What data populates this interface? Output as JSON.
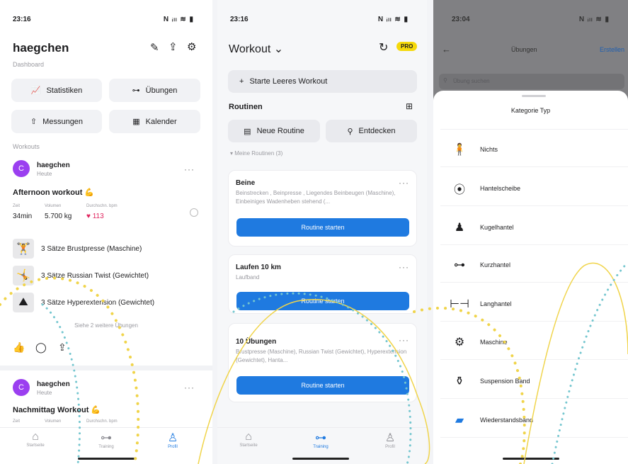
{
  "phone1": {
    "time": "23:16",
    "signal": "N ᵢₗₗ ≋ ▮",
    "user": "haegchen",
    "subtitle": "Dashboard",
    "buttons": {
      "stats": "Statistiken",
      "exercises": "Übungen",
      "measurements": "Messungen",
      "calendar": "Kalender"
    },
    "section": "Workouts",
    "post1": {
      "avatar": "C",
      "name": "haegchen",
      "when": "Heute",
      "title": "Afternoon workout 💪",
      "stat_labels": [
        "Zeit",
        "Volumen",
        "Durchschn. bpm"
      ],
      "stat_values": [
        "34min",
        "5.700 kg",
        "♥ 113"
      ],
      "exercises": [
        "3 Sätze Brustpresse (Maschine)",
        "3 Sätze Russian Twist (Gewichtet)",
        "3 Sätze Hyperextension (Gewichtet)"
      ],
      "more": "Siehe 2 weitere Übungen"
    },
    "post2": {
      "avatar": "C",
      "name": "haegchen",
      "when": "Heute",
      "title": "Nachmittag Workout 💪",
      "stat_labels": [
        "Zeit",
        "Volumen",
        "Durchschn. bpm"
      ]
    },
    "tabs": [
      "Startseite",
      "Training",
      "Profil"
    ]
  },
  "phone2": {
    "time": "23:16",
    "signal": "N ᵢₗₗ ≋ ▮",
    "title": "Workout ⌄",
    "pro": "PRO",
    "start_empty": "Starte Leeres Workout",
    "routines_header": "Routinen",
    "new_routine": "Neue Routine",
    "discover": "Entdecken",
    "my_routines": "Meine Routinen (3)",
    "routines": [
      {
        "title": "Beine",
        "desc": "Beinstrecken , Beinpresse , Liegendes Beinbeugen (Maschine), Einbeiniges Wadenheben stehend (...",
        "btn": "Routine starten"
      },
      {
        "title": "Laufen 10 km",
        "desc": "Laufband",
        "btn": "Routine starten"
      },
      {
        "title": "10 Übungen",
        "desc": "Brustpresse (Maschine), Russian Twist (Gewichtet), Hyperextension (Gewichtet), Hanta...",
        "btn": "Routine starten"
      }
    ],
    "tabs": [
      "Startseite",
      "Training",
      "Profil"
    ]
  },
  "phone3": {
    "time": "23:04",
    "signal": "N ᵢₗₗ ≋ ▮",
    "title": "Übungen",
    "create": "Erstellen",
    "search_placeholder": "Übung suchen",
    "sheet_title": "Kategorie Typ",
    "categories": [
      "Nichts",
      "Hantelscheibe",
      "Kugelhantel",
      "Kurzhantel",
      "Langhantel",
      "Maschine",
      "Suspension Band",
      "Wiederstandsband"
    ]
  },
  "colors": {
    "accent": "#1f7ae0",
    "pro": "#f5d90a",
    "heart": "#e0245e",
    "overlay_yellow": "#f0d44a",
    "overlay_teal": "#74c6cf"
  }
}
